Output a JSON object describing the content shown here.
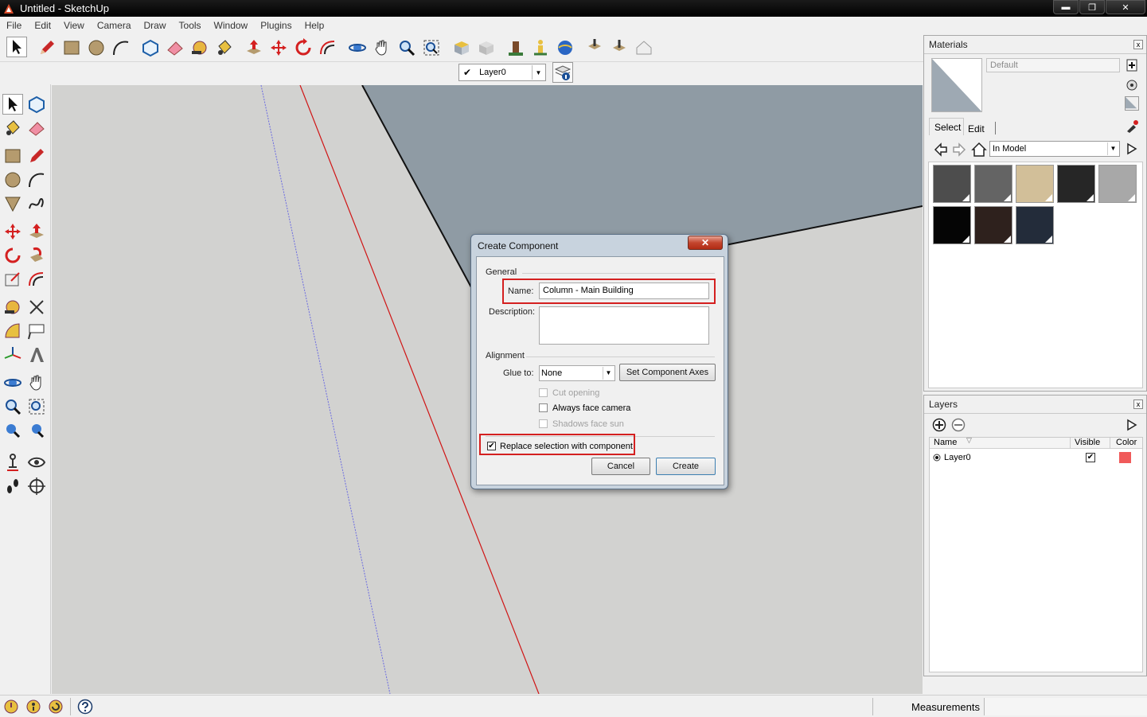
{
  "window": {
    "title": "Untitled - SketchUp",
    "min_glyph": "▬",
    "max_glyph": "❐",
    "close_glyph": "✕"
  },
  "menu": [
    "File",
    "Edit",
    "View",
    "Camera",
    "Draw",
    "Tools",
    "Window",
    "Plugins",
    "Help"
  ],
  "layer_toolbar": {
    "selected_layer": "Layer0",
    "check": "✔",
    "arrow": "▼"
  },
  "materials_panel": {
    "title": "Materials",
    "close_glyph": "x",
    "name_value": "Default",
    "tab_select": "Select",
    "tab_edit": "Edit",
    "collection": "In Model",
    "swatch_colors": [
      "#4d4d4d",
      "#646464",
      "#d2bf99",
      "#262626",
      "#a8a8a8",
      "#050505",
      "#2e211d",
      "#232c3a"
    ]
  },
  "layers_panel": {
    "title": "Layers",
    "close_glyph": "x",
    "col_name": "Name",
    "col_visible": "Visible",
    "col_color": "Color",
    "rows": [
      {
        "name": "Layer0",
        "visible": true,
        "color": "#f05a5a"
      }
    ]
  },
  "status": {
    "measurements_label": "Measurements"
  },
  "dialog": {
    "title": "Create Component",
    "close_glyph": "✕",
    "group_general": "General",
    "name_label": "Name:",
    "name_value": "Column - Main Building",
    "description_label": "Description:",
    "description_value": "",
    "group_alignment": "Alignment",
    "glue_label": "Glue to:",
    "glue_value": "None",
    "set_axes_label": "Set Component Axes",
    "cut_opening_label": "Cut opening",
    "always_face_label": "Always face camera",
    "shadows_label": "Shadows face sun",
    "replace_label": "Replace selection with component",
    "replace_checked": true,
    "cancel_label": "Cancel",
    "create_label": "Create"
  },
  "colors": {
    "viewport_bg": "#d2d2d0",
    "face_color": "#8f9ba4",
    "red_axis": "#d01414",
    "blue_axis": "#6a6ae0",
    "highlight": "#d42020"
  }
}
